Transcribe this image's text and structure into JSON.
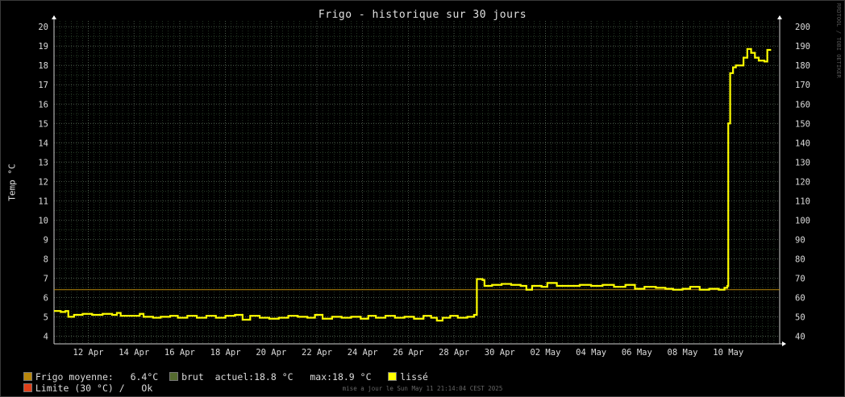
{
  "watermark": "RRDTOOL / TOBI OETIKER",
  "footer": "mise a jour le Sun May 11 21:14:04 CEST 2025",
  "legend": {
    "moyenne_label": "Frigo moyenne:",
    "moyenne_value": "6.4°C",
    "brut_label": "brut",
    "actuel": "actuel:18.8 °C",
    "max": "max:18.9 °C",
    "lisse_label": "lissé",
    "limite_label": "Limite (30 °C) /",
    "limite_status": "Ok"
  },
  "colors": {
    "background": "#000000",
    "series": "#ffff00",
    "mean": "#b8860b",
    "brut": "#556b2f",
    "limite": "#e0401a",
    "grid_minor": "#3a5a3a",
    "grid_major": "#607060"
  },
  "chart_data": {
    "type": "line",
    "title": "Frigo - historique sur 30 jours",
    "ylabel": "Temp °C",
    "xlabel": "",
    "ylim": [
      3.6,
      20.3
    ],
    "xlim": [
      "2025-04-10T12:00",
      "2025-05-12T06:00"
    ],
    "y_ticks": [
      4,
      5,
      6,
      7,
      8,
      9,
      10,
      11,
      12,
      13,
      14,
      15,
      16,
      17,
      18,
      19,
      20
    ],
    "y2_ticks": [
      40,
      50,
      60,
      70,
      80,
      90,
      100,
      110,
      120,
      130,
      140,
      150,
      160,
      170,
      180,
      190,
      200
    ],
    "x_ticks": [
      {
        "date": "2025-04-12T00:00",
        "label": "12 Apr"
      },
      {
        "date": "2025-04-14T00:00",
        "label": "14 Apr"
      },
      {
        "date": "2025-04-16T00:00",
        "label": "16 Apr"
      },
      {
        "date": "2025-04-18T00:00",
        "label": "18 Apr"
      },
      {
        "date": "2025-04-20T00:00",
        "label": "20 Apr"
      },
      {
        "date": "2025-04-22T00:00",
        "label": "22 Apr"
      },
      {
        "date": "2025-04-24T00:00",
        "label": "24 Apr"
      },
      {
        "date": "2025-04-26T00:00",
        "label": "26 Apr"
      },
      {
        "date": "2025-04-28T00:00",
        "label": "28 Apr"
      },
      {
        "date": "2025-04-30T00:00",
        "label": "30 Apr"
      },
      {
        "date": "2025-05-02T00:00",
        "label": "02 May"
      },
      {
        "date": "2025-05-04T00:00",
        "label": "04 May"
      },
      {
        "date": "2025-05-06T00:00",
        "label": "06 May"
      },
      {
        "date": "2025-05-08T00:00",
        "label": "08 May"
      },
      {
        "date": "2025-05-10T00:00",
        "label": "10 May"
      }
    ],
    "mean_line": 6.4,
    "grid": true,
    "legend_position": "bottom-left",
    "series": [
      {
        "name": "lissé",
        "points": [
          [
            "2025-04-10T12:00",
            5.3
          ],
          [
            "2025-04-10T19:00",
            5.25
          ],
          [
            "2025-04-11T00:00",
            5.3
          ],
          [
            "2025-04-11T03:00",
            5.0
          ],
          [
            "2025-04-11T09:00",
            5.1
          ],
          [
            "2025-04-11T18:00",
            5.15
          ],
          [
            "2025-04-12T04:00",
            5.1
          ],
          [
            "2025-04-12T15:00",
            5.15
          ],
          [
            "2025-04-13T01:00",
            5.1
          ],
          [
            "2025-04-13T06:00",
            5.2
          ],
          [
            "2025-04-13T10:00",
            5.05
          ],
          [
            "2025-04-13T22:00",
            5.05
          ],
          [
            "2025-04-14T06:00",
            5.15
          ],
          [
            "2025-04-14T10:00",
            5.0
          ],
          [
            "2025-04-14T20:00",
            4.95
          ],
          [
            "2025-04-15T04:00",
            5.0
          ],
          [
            "2025-04-15T14:00",
            5.05
          ],
          [
            "2025-04-15T22:00",
            4.95
          ],
          [
            "2025-04-16T08:00",
            5.05
          ],
          [
            "2025-04-16T18:00",
            4.95
          ],
          [
            "2025-04-17T04:00",
            5.05
          ],
          [
            "2025-04-17T14:00",
            4.95
          ],
          [
            "2025-04-18T00:00",
            5.05
          ],
          [
            "2025-04-18T10:00",
            5.1
          ],
          [
            "2025-04-18T18:00",
            4.85
          ],
          [
            "2025-04-19T02:00",
            5.05
          ],
          [
            "2025-04-19T12:00",
            4.95
          ],
          [
            "2025-04-19T22:00",
            4.9
          ],
          [
            "2025-04-20T08:00",
            4.95
          ],
          [
            "2025-04-20T18:00",
            5.05
          ],
          [
            "2025-04-21T04:00",
            5.0
          ],
          [
            "2025-04-21T14:00",
            4.95
          ],
          [
            "2025-04-21T22:00",
            5.1
          ],
          [
            "2025-04-22T06:00",
            4.9
          ],
          [
            "2025-04-22T16:00",
            5.0
          ],
          [
            "2025-04-23T02:00",
            4.95
          ],
          [
            "2025-04-23T12:00",
            5.0
          ],
          [
            "2025-04-23T22:00",
            4.9
          ],
          [
            "2025-04-24T06:00",
            5.05
          ],
          [
            "2025-04-24T14:00",
            4.95
          ],
          [
            "2025-04-25T00:00",
            5.05
          ],
          [
            "2025-04-25T10:00",
            4.95
          ],
          [
            "2025-04-25T20:00",
            5.0
          ],
          [
            "2025-04-26T06:00",
            4.9
          ],
          [
            "2025-04-26T16:00",
            5.05
          ],
          [
            "2025-04-27T00:00",
            4.95
          ],
          [
            "2025-04-27T06:00",
            4.8
          ],
          [
            "2025-04-27T12:00",
            4.95
          ],
          [
            "2025-04-27T20:00",
            5.05
          ],
          [
            "2025-04-28T04:00",
            4.95
          ],
          [
            "2025-04-28T14:00",
            5.0
          ],
          [
            "2025-04-28T21:00",
            5.1
          ],
          [
            "2025-04-29T00:00",
            6.95
          ],
          [
            "2025-04-29T06:00",
            6.9
          ],
          [
            "2025-04-29T08:00",
            6.6
          ],
          [
            "2025-04-29T16:00",
            6.65
          ],
          [
            "2025-04-30T02:00",
            6.7
          ],
          [
            "2025-04-30T12:00",
            6.65
          ],
          [
            "2025-04-30T22:00",
            6.6
          ],
          [
            "2025-05-01T04:00",
            6.4
          ],
          [
            "2025-05-01T10:00",
            6.6
          ],
          [
            "2025-05-01T20:00",
            6.55
          ],
          [
            "2025-05-02T02:00",
            6.75
          ],
          [
            "2025-05-02T12:00",
            6.6
          ],
          [
            "2025-05-03T00:00",
            6.6
          ],
          [
            "2025-05-03T12:00",
            6.65
          ],
          [
            "2025-05-04T00:00",
            6.6
          ],
          [
            "2025-05-04T12:00",
            6.65
          ],
          [
            "2025-05-05T00:00",
            6.55
          ],
          [
            "2025-05-05T12:00",
            6.65
          ],
          [
            "2025-05-05T22:00",
            6.45
          ],
          [
            "2025-05-06T08:00",
            6.55
          ],
          [
            "2025-05-06T20:00",
            6.5
          ],
          [
            "2025-05-07T06:00",
            6.45
          ],
          [
            "2025-05-07T14:00",
            6.4
          ],
          [
            "2025-05-08T00:00",
            6.45
          ],
          [
            "2025-05-08T08:00",
            6.55
          ],
          [
            "2025-05-08T18:00",
            6.4
          ],
          [
            "2025-05-09T04:00",
            6.45
          ],
          [
            "2025-05-09T14:00",
            6.4
          ],
          [
            "2025-05-09T20:00",
            6.5
          ],
          [
            "2025-05-09T23:00",
            6.6
          ],
          [
            "2025-05-10T00:00",
            15.0
          ],
          [
            "2025-05-10T02:00",
            17.6
          ],
          [
            "2025-05-10T05:00",
            17.9
          ],
          [
            "2025-05-10T08:00",
            18.0
          ],
          [
            "2025-05-10T14:00",
            18.0
          ],
          [
            "2025-05-10T16:00",
            18.4
          ],
          [
            "2025-05-10T20:00",
            18.85
          ],
          [
            "2025-05-11T00:00",
            18.65
          ],
          [
            "2025-05-11T04:00",
            18.4
          ],
          [
            "2025-05-11T08:00",
            18.25
          ],
          [
            "2025-05-11T14:00",
            18.2
          ],
          [
            "2025-05-11T17:00",
            18.8
          ],
          [
            "2025-05-11T21:00",
            18.8
          ]
        ]
      }
    ]
  }
}
